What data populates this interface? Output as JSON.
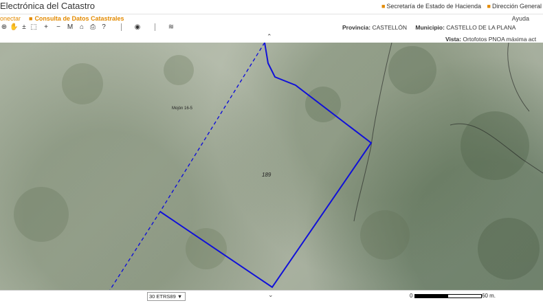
{
  "header": {
    "title": "Electrónica del Catastro",
    "links": [
      "Secretaría de Estado de Hacienda",
      "Dirección General"
    ]
  },
  "menu": {
    "desconectar": "onectar",
    "consulta": "Consulta de Datos Catastrales",
    "ayuda": "Ayuda"
  },
  "toolbar": {
    "icons": [
      "globe-icon",
      "hand-icon",
      "zoom-in-out-icon",
      "select-area-icon",
      "zoom-in-icon",
      "zoom-out-icon",
      "measure-icon",
      "home-icon",
      "print-icon",
      "help-icon",
      "marker-icon",
      "layers-icon"
    ],
    "help_glyph": "?",
    "zoom_in_glyph": "+",
    "zoom_out_glyph": "−",
    "measure_glyph": "M",
    "pm_glyph": "±"
  },
  "location": {
    "provincia_label": "Provincia:",
    "provincia_value": "CASTELLÓN",
    "municipio_label": "Municipio:",
    "municipio_value": "CASTELLO DE LA PLANA"
  },
  "vista": {
    "label": "Vista:",
    "value": "Ortofotos PNOA máxima act"
  },
  "map": {
    "parcel_number": "189",
    "boundary_label": "Mojón 16-5",
    "boundary_color": "#1010d8"
  },
  "footer": {
    "srs": "30 ETRS89 ▼",
    "scale_start": "0",
    "scale_end": "60 m."
  },
  "colors": {
    "accent": "#e38a00"
  }
}
